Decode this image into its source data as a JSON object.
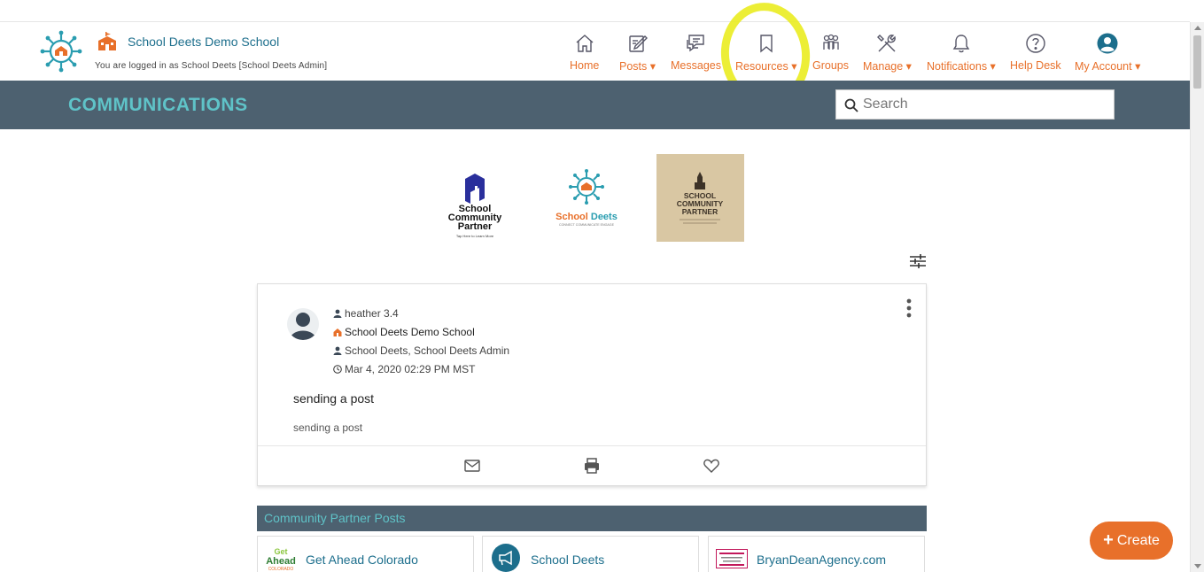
{
  "header": {
    "school_name": "School Deets Demo School",
    "logged_in_text": "You are logged in as School Deets [School Deets Admin]"
  },
  "nav": [
    {
      "label": "Home",
      "icon": "home-icon"
    },
    {
      "label": "Posts ▾",
      "icon": "edit-icon"
    },
    {
      "label": "Messages",
      "icon": "chat-icon"
    },
    {
      "label": "Resources ▾",
      "icon": "bookmark-icon"
    },
    {
      "label": "Groups",
      "icon": "groups-icon"
    },
    {
      "label": "Manage ▾",
      "icon": "tools-icon"
    },
    {
      "label": "Notifications ▾",
      "icon": "bell-icon"
    },
    {
      "label": "Help Desk",
      "icon": "help-icon"
    },
    {
      "label": "My Account ▾",
      "icon": "account-icon"
    }
  ],
  "band": {
    "title": "COMMUNICATIONS",
    "search_placeholder": "Search"
  },
  "sponsors": {
    "scp1": {
      "line1": "School",
      "line2": "Community",
      "line3": "Partner",
      "tagline": "Tap Here to Learn More"
    },
    "sd": {
      "name1": "School",
      "name2": "Deets",
      "tagline": "CONNECT COMMUNICATE ENGAGE"
    },
    "scp2": {
      "line1": "SCHOOL",
      "line2": "COMMUNITY",
      "line3": "PARTNER"
    }
  },
  "post": {
    "author": "heather 3.4",
    "school": "School Deets Demo School",
    "recipients": "School Deets, School Deets Admin",
    "timestamp": "Mar 4, 2020 02:29 PM MST",
    "title": "sending a post",
    "body": "sending a post"
  },
  "community_partners": {
    "title": "Community Partner Posts",
    "partners": [
      "Get Ahead Colorado",
      "School Deets",
      "BryanDeanAgency.com"
    ],
    "getahead_logo_text": {
      "top": "Get",
      "mid": "Ahead",
      "bottom": "COLORADO"
    }
  },
  "create_button": {
    "plus": "+",
    "label": "Create"
  },
  "colors": {
    "accent": "#e8702a",
    "band": "#4d6170",
    "teal": "#5fc3c8",
    "link": "#1c6e8c",
    "highlight": "#e9ec1a"
  }
}
